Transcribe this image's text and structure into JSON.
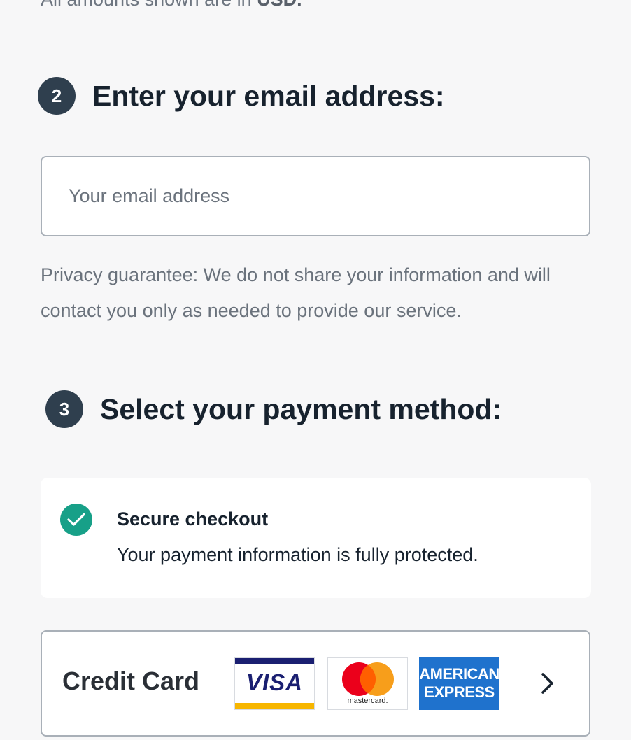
{
  "top_note": {
    "text": "All amounts shown are in ",
    "currency": "USD."
  },
  "step2": {
    "number": "2",
    "title": "Enter your email address:"
  },
  "email": {
    "placeholder": "Your email address",
    "value": ""
  },
  "privacy_text": "Privacy guarantee: We do not share your information and will contact you only as needed to provide our service.",
  "step3": {
    "number": "3",
    "title": "Select your payment method:"
  },
  "secure": {
    "title": "Secure checkout",
    "subtitle": "Your payment information is fully protected.",
    "icon": "check-circle-icon",
    "color": "#17a088"
  },
  "payment_methods": [
    {
      "label": "Credit Card",
      "logos": {
        "visa": "VISA",
        "mastercard": "mastercard.",
        "amex_line1": "AMERICAN",
        "amex_line2": "EXPRESS"
      },
      "icon": "chevron-right-icon"
    }
  ],
  "colors": {
    "background": "#f7f7f8",
    "step_badge": "#2f3f4e",
    "heading": "#17222e",
    "muted_text": "#6a727c",
    "border": "#a9b0b8",
    "visa_blue": "#1a1f71",
    "visa_gold": "#f7b600",
    "mc_red": "#eb001b",
    "mc_orange": "#f79e1b",
    "amex_blue": "#1f72cd"
  }
}
